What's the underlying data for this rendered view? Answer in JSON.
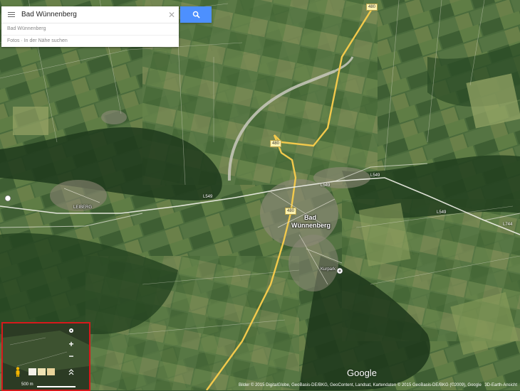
{
  "search": {
    "value": "Bad Wünnenberg",
    "suggestion_1": "Bad Wünnenberg",
    "suggestion_2": "Fotos · In der Nähe suchen"
  },
  "labels": {
    "town_line1": "Bad",
    "town_line2": "Wünnenberg",
    "leiberg": "LEIBERG",
    "kurpark": "Kurpark"
  },
  "roads": {
    "shield_top": "480",
    "shield_mid": "480",
    "shield_town": "480",
    "l549_a": "L549",
    "l549_b": "L549",
    "l549_c": "L549",
    "l744": "L744",
    "l549_left": "L549"
  },
  "minimap": {
    "scale_text": "500 m"
  },
  "footer": {
    "attribution": "Bilder © 2015 DigitalGlobe, GeoBasis-DE/BKG, GeoContent, Landsat, Kartendaten © 2015 GeoBasis-DE/BKG (©2009), Google",
    "mode": "3D-Earth-Ansicht",
    "logo": "Google"
  },
  "colors": {
    "search_button": "#4d90fe",
    "minimap_border": "#d7191c",
    "highway": "#f2c94c"
  },
  "icons": {
    "menu": "hamburger-icon",
    "search": "magnifier-icon",
    "clear": "close-icon",
    "pegman": "pegman-icon"
  }
}
